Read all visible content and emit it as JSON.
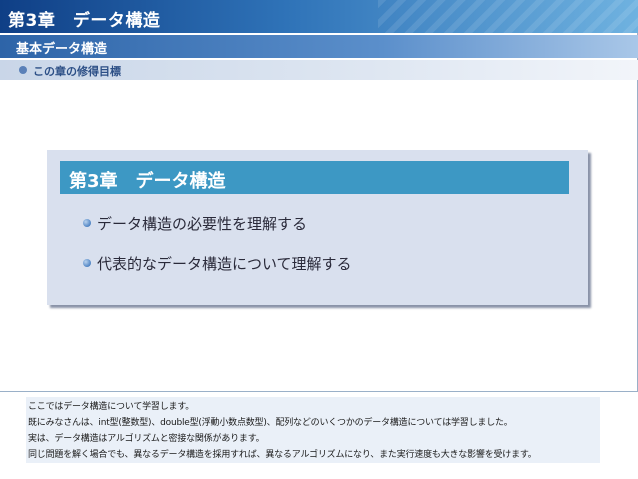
{
  "header": {
    "chapter_title": "第3章　データ構造",
    "section_title": "基本データ構造",
    "objective_label": "この章の修得目標"
  },
  "content": {
    "title": "第3章　データ構造",
    "bullets": [
      "データ構造の必要性を理解する",
      "代表的なデータ構造について理解する"
    ]
  },
  "notes": {
    "lines": [
      "ここではデータ構造について学習します。",
      "既にみなさんは、int型(整数型)、double型(浮動小数点数型)、配列などのいくつかのデータ構造については学習しました。",
      "実は、データ構造はアルゴリズムと密接な関係があります。",
      "同じ問題を解く場合でも、異なるデータ構造を採用すれば、異なるアルゴリズムになり、また実行速度も大きな影響を受けます。"
    ]
  }
}
